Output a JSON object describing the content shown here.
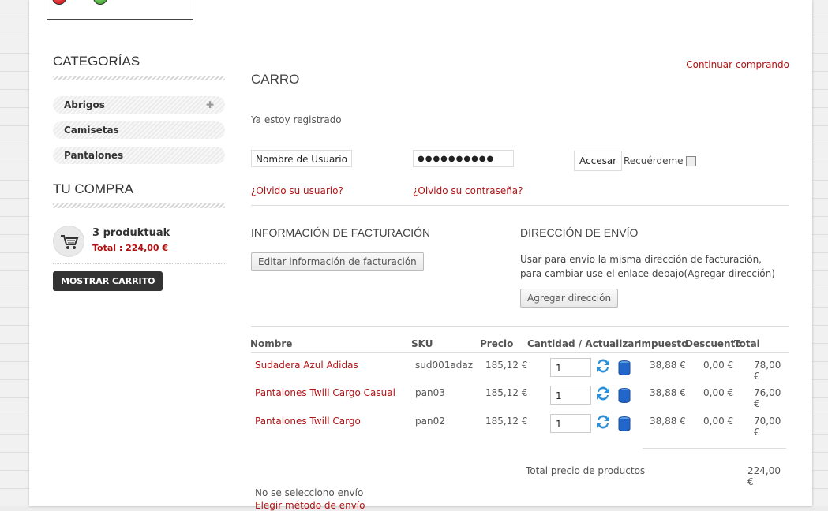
{
  "sidebar": {
    "categories_title": "CATEGORÍAS",
    "categories": [
      {
        "label": "Abrigos",
        "expandable": true
      },
      {
        "label": "Camisetas",
        "expandable": false
      },
      {
        "label": "Pantalones",
        "expandable": false
      }
    ],
    "purchase_title": "TU COMPRA",
    "cart_count": "3 produktuak",
    "cart_total": "Total : 224,00 €",
    "show_cart": "MOSTRAR CARRITO"
  },
  "main": {
    "continue_link": "Continuar comprando",
    "title": "CARRO",
    "registered_label": "Ya estoy registrado",
    "login": {
      "username_value": "Nombre de Usuario",
      "password_value": "●●●●●●●●●●",
      "access_button": "Accesar",
      "remember_label": "Recuérdeme",
      "forgot_user": "¿Olvido su usuario?",
      "forgot_password": "¿Olvido su contraseña?"
    },
    "billing": {
      "title": "INFORMACIÓN DE FACTURACIÓN",
      "edit_button": "Editar información de facturación"
    },
    "shipping": {
      "title": "DIRECCIÓN DE ENVÍO",
      "text": "Usar para envío la misma dirección de facturación, para cambiar use el enlace debajo(Agregar dirección)",
      "add_button": "Agregar dirección"
    },
    "table": {
      "headers": [
        "Nombre",
        "SKU",
        "Precio",
        "Cantidad / Actualizar",
        "Impuesto",
        "Descuento",
        "Total"
      ],
      "rows": [
        {
          "name": "Sudadera Azul Adidas",
          "sku": "sud001adaz",
          "price": "185,12 €",
          "qty": "1",
          "tax": "38,88 €",
          "discount": "0,00 €",
          "total": "78,00 €"
        },
        {
          "name": "Pantalones Twill Cargo Casual",
          "sku": "pan03",
          "price": "185,12 €",
          "qty": "1",
          "tax": "38,88 €",
          "discount": "0,00 €",
          "total": "76,00 €"
        },
        {
          "name": "Pantalones Twill Cargo",
          "sku": "pan02",
          "price": "185,12 €",
          "qty": "1",
          "tax": "38,88 €",
          "discount": "0,00 €",
          "total": "70,00 €"
        }
      ],
      "products_total_label": "Total precio de productos",
      "products_total_value": "224,00 €"
    },
    "shipping_status": "No se selecciono envío",
    "shipping_link": "Elegir método de envío"
  },
  "colors": {
    "link": "#b01515",
    "dark_button": "#333333"
  }
}
